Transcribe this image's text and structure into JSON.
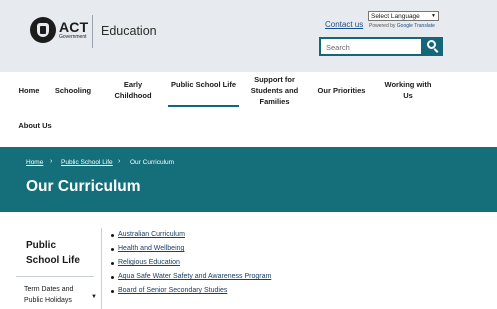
{
  "header": {
    "logo_act": "ACT",
    "logo_gov": "Government",
    "site_name": "Education",
    "contact_label": "Contact us",
    "language_select": "Select Language",
    "powered_by": "Powered by",
    "google_translate": "Google Translate",
    "search_placeholder": "Search"
  },
  "nav": {
    "items": [
      {
        "label": "Home"
      },
      {
        "label": "Schooling"
      },
      {
        "label": "Early Childhood"
      },
      {
        "label": "Public School Life"
      },
      {
        "label": "Support for Students and Families"
      },
      {
        "label": "Our Priorities"
      },
      {
        "label": "Working with Us"
      },
      {
        "label": "About Us"
      }
    ],
    "active": "Public School Life"
  },
  "banner": {
    "breadcrumb": [
      "Home",
      "Public School Life",
      "Our Curriculum"
    ],
    "title": "Our Curriculum"
  },
  "sidebar": {
    "title": "Public School Life",
    "items": [
      {
        "label": "Term Dates and Public Holidays"
      }
    ]
  },
  "content": {
    "links": [
      "Australian Curriculum",
      "Health and Wellbeing",
      "Religious Education",
      "Aqua Safe Water Safety and Awareness Program",
      "Board of Senior Secondary Studies"
    ]
  },
  "colors": {
    "teal": "#146f7a",
    "header_bg": "#e7eaef",
    "link": "#1b3f66"
  }
}
